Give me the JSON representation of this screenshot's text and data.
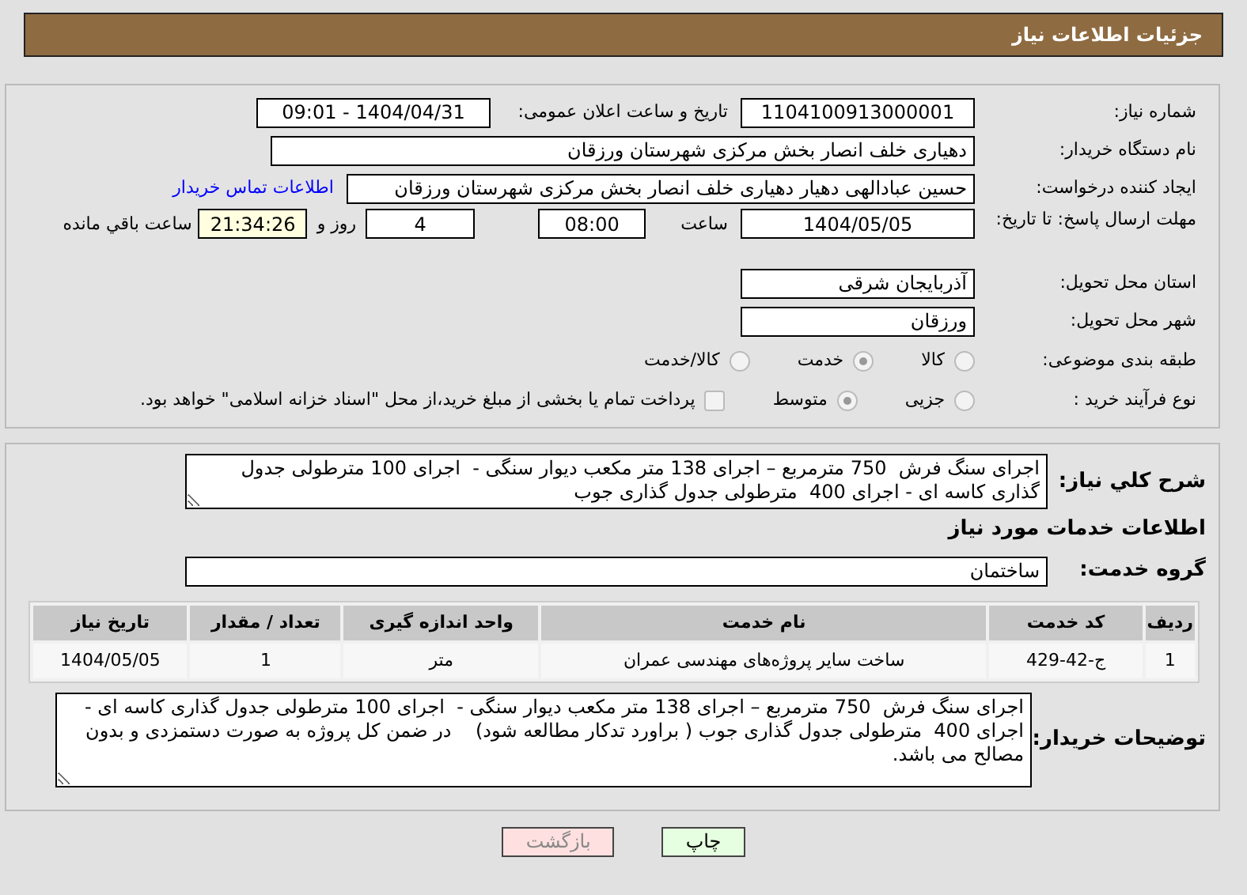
{
  "title": "جزئیات اطلاعات نیاز",
  "need_number": {
    "label": "شماره نیاز:",
    "value": "1104100913000001"
  },
  "announce": {
    "label": "تاریخ و ساعت اعلان عمومی:",
    "value": "1404/04/31 - 09:01"
  },
  "buyer_org": {
    "label": "نام دستگاه خریدار:",
    "value": "دهیاری خلف انصار بخش مرکزی شهرستان ورزقان"
  },
  "requester": {
    "label": "ایجاد کننده درخواست:",
    "value": "حسین عبادالهی دهیار دهیاری خلف انصار بخش مرکزی شهرستان ورزقان",
    "link": "اطلاعات تماس خریدار"
  },
  "deadline": {
    "label": "مهلت ارسال پاسخ: تا تاریخ:",
    "date": "1404/05/05",
    "time_label": "ساعت",
    "time": "08:00",
    "days": "4",
    "days_label": "روز و",
    "remaining": "21:34:26",
    "remaining_label": "ساعت باقي مانده"
  },
  "province": {
    "label": "استان محل تحویل:",
    "value": "آذربایجان شرقی"
  },
  "city": {
    "label": "شهر محل تحویل:",
    "value": "ورزقان"
  },
  "category": {
    "label": "طبقه بندی موضوعی:",
    "options": [
      {
        "label": "کالا",
        "selected": false
      },
      {
        "label": "خدمت",
        "selected": true
      },
      {
        "label": "کالا/خدمت",
        "selected": false
      }
    ]
  },
  "process": {
    "label": "نوع فرآیند خرید :",
    "options": [
      {
        "label": "جزیی",
        "selected": false
      },
      {
        "label": "متوسط",
        "selected": true
      }
    ],
    "payment": {
      "label": "پرداخت تمام یا بخشی از مبلغ خرید،از محل \"اسناد خزانه اسلامی\" خواهد بود.",
      "checked": false
    }
  },
  "summary": {
    "label": "شرح کلي نیاز:",
    "value": "اجرای سنگ فرش  750 مترمربع – اجرای 138 متر مکعب دیوار سنگی -  اجرای 100 مترطولی جدول گذاری کاسه ای - اجرای 400  مترطولی جدول گذاری جوب"
  },
  "services_heading": "اطلاعات خدمات مورد نیاز",
  "service_group": {
    "label": "گروه خدمت:",
    "value": "ساختمان"
  },
  "table": {
    "columns": [
      "ردیف",
      "کد خدمت",
      "نام خدمت",
      "واحد اندازه گیری",
      "تعداد / مقدار",
      "تاریخ نیاز"
    ],
    "rows": [
      [
        "1",
        "ج-42-429",
        "ساخت سایر پروژه‌های مهندسی عمران",
        "متر",
        "1",
        "1404/05/05"
      ]
    ]
  },
  "buyer_notes": {
    "label": "توضیحات خریدار:",
    "value": "اجرای سنگ فرش  750 مترمربع – اجرای 138 متر مکعب دیوار سنگی -  اجرای 100 مترطولی جدول گذاری کاسه ای - اجرای 400  مترطولی جدول گذاری جوب ( براورد تدکار مطالعه شود)    در ضمن کل پروژه به صورت دستمزدی و بدون مصالح می باشد."
  },
  "buttons": [
    {
      "label": "چاپ",
      "kind": "print"
    },
    {
      "label": "بازگشت",
      "kind": "back"
    }
  ]
}
